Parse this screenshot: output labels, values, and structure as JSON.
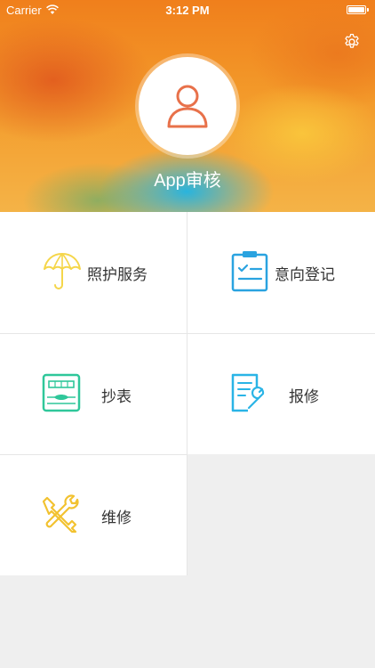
{
  "status_bar": {
    "carrier": "Carrier",
    "time": "3:12 PM"
  },
  "profile": {
    "name": "App审核",
    "accent_color": "#e8714a"
  },
  "menu": {
    "items": [
      {
        "label": "照护服务",
        "icon": "umbrella-icon"
      },
      {
        "label": "意向登记",
        "icon": "clipboard-icon"
      },
      {
        "label": "抄表",
        "icon": "meter-icon"
      },
      {
        "label": "报修",
        "icon": "repair-document-icon"
      },
      {
        "label": "维修",
        "icon": "tools-icon"
      }
    ]
  },
  "colors": {
    "umbrella": "#f5d64a",
    "clipboard": "#2aa3e0",
    "meter": "#2fc79a",
    "repair": "#2ab4e6",
    "tools": "#f2c230"
  }
}
